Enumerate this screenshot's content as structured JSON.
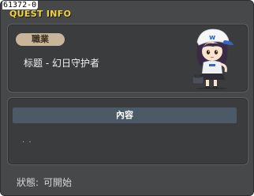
{
  "window": {
    "id": "61372-0",
    "title": "QUEST INFO"
  },
  "quest": {
    "job_label": "職業",
    "title": "标题 - 幻日守护者",
    "npc_icon": "npc-girl-with-w-cap"
  },
  "content": {
    "header": "內容",
    "body": ". ."
  },
  "status": {
    "label": "狀態:",
    "value": "可開始"
  },
  "colors": {
    "window_bg": "#464849",
    "panel_bg": "#3b3c3d",
    "title_yellow": "#f1d33b",
    "job_badge": "#c9b59a",
    "content_header": "#4b5a66"
  }
}
